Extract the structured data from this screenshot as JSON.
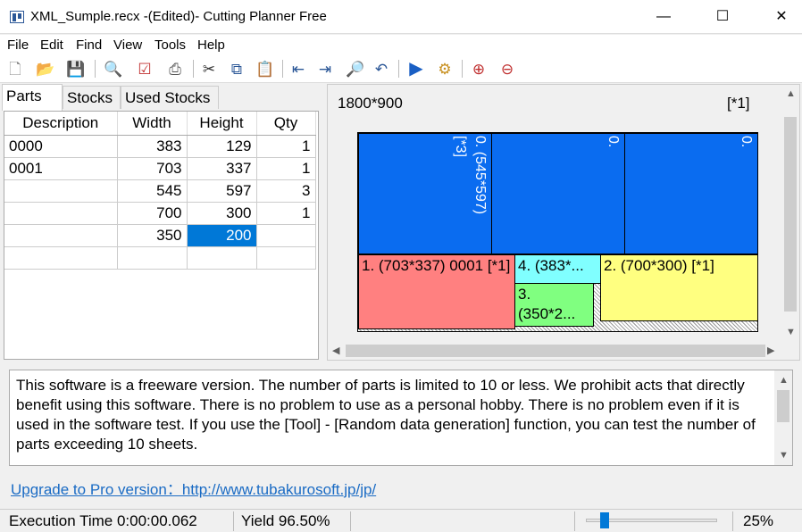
{
  "window": {
    "title": "XML_Sumple.recx -(Edited)- Cutting Planner Free"
  },
  "menu": [
    "File",
    "Edit",
    "Find",
    "View",
    "Tools",
    "Help"
  ],
  "tabs": [
    "Parts",
    "Stocks",
    "Used Stocks"
  ],
  "grid": {
    "headers": [
      "Description",
      "Width",
      "Height",
      "Qty"
    ],
    "rows": [
      [
        "0000",
        "383",
        "129",
        "1"
      ],
      [
        "0001",
        "703",
        "337",
        "1"
      ],
      [
        "",
        "545",
        "597",
        "3"
      ],
      [
        "",
        "700",
        "300",
        "1"
      ],
      [
        "",
        "350",
        "200",
        ""
      ],
      [
        "",
        "",
        "",
        ""
      ]
    ]
  },
  "preview": {
    "stock_size": "1800*900",
    "stock_count": "[*1]",
    "parts": {
      "p0a": "0. (545*597)",
      "p0a_count": "[*3]",
      "p0b": "0.",
      "p0c": "0.",
      "p1": "1. (703*337) 0001 [*1]",
      "p4": "4. (383*...",
      "p3": "3. (350*2...",
      "p2": "2. (700*300)  [*1]"
    }
  },
  "message": "This software is a freeware version. The number of parts is limited to 10 or less. We prohibit acts that directly benefit using this software. There is no problem to use as a personal hobby. There is no problem even if it is used in the software test. If you use the [Tool] - [Random data generation] function, you can test the number of parts exceeding 10 sheets.",
  "link": "Upgrade to Pro version：http://www.tubakurosoft.jp/jp/",
  "status": {
    "exec_time": "Execution Time 0:00:00.062",
    "yield": "Yield 96.50%",
    "zoom_value": 0.25,
    "zoom": "25%"
  },
  "colors": {
    "part0": "#0a6cf0",
    "part1": "#ff8080",
    "part2": "#ffff80",
    "part3": "#80ff80",
    "part4": "#80ffff",
    "selection": "#0078d7",
    "link": "#1a6bc4"
  }
}
